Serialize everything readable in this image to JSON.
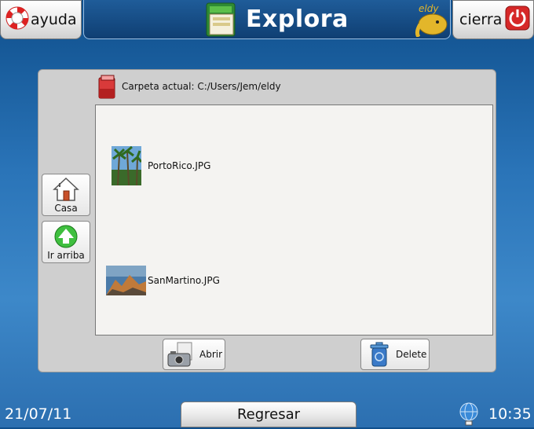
{
  "header": {
    "help_label": "ayuda",
    "title": "Explora",
    "close_label": "cierra",
    "logo_text": "eldy"
  },
  "browser": {
    "path_label": "Carpeta actual: C:/Users/Jem/eldy",
    "home_label": "Casa",
    "up_label": "Ir arriba",
    "files": [
      {
        "name": "PortoRico.JPG"
      },
      {
        "name": "SanMartino.JPG"
      }
    ],
    "open_label": "Abrir",
    "delete_label": "Delete"
  },
  "footer": {
    "date": "21/07/11",
    "back_label": "Regresar",
    "time": "10:35"
  },
  "colors": {
    "background": "#2a74b8",
    "title_bar": "#154a83",
    "panel": "#cfcfcf",
    "file_area": "#f4f3f1",
    "close_red": "#d62828"
  }
}
